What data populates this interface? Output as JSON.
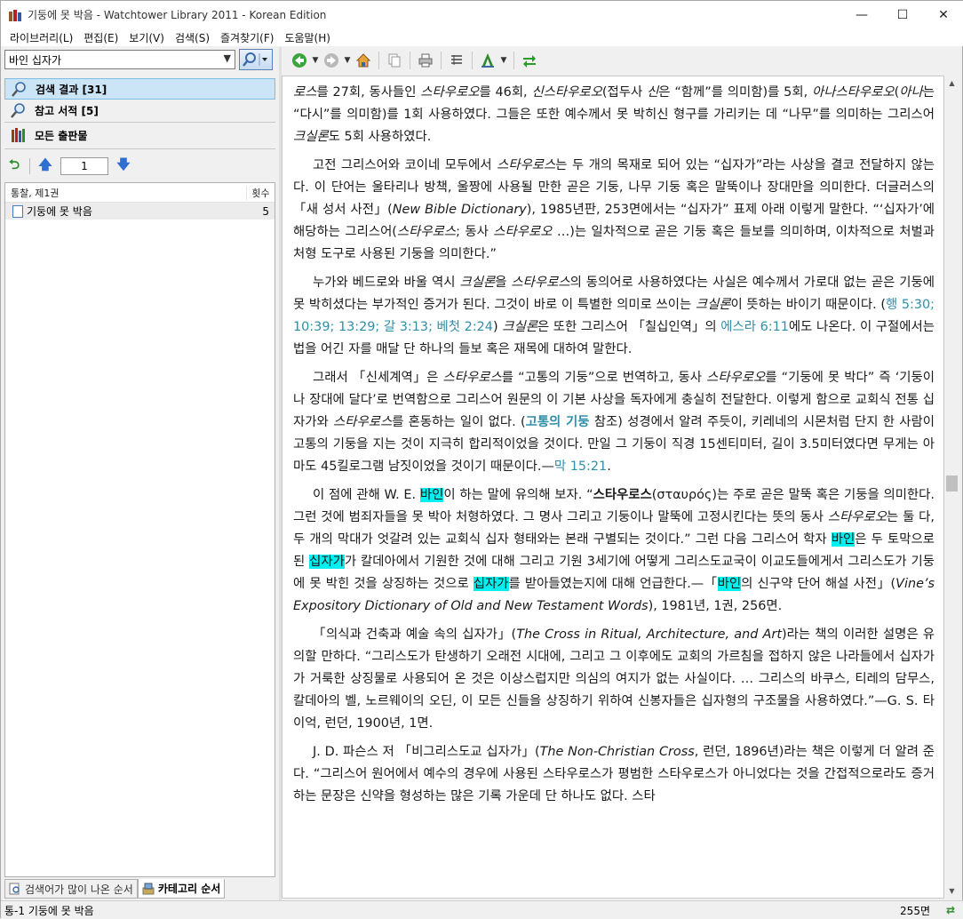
{
  "window": {
    "title": "기둥에 못 박음 - Watchtower Library 2011 - Korean Edition",
    "minimize": "—",
    "maximize": "☐",
    "close": "✕"
  },
  "menu": [
    "라이브러리(L)",
    "편집(E)",
    "보기(V)",
    "검색(S)",
    "즐겨찾기(F)",
    "도움말(H)"
  ],
  "search": {
    "query": "바인 십자가"
  },
  "nav": {
    "results_label": "검색 결과 [31]",
    "references_label": "참고 서적 [5]",
    "all_pubs_label": "모든 출판물"
  },
  "pager": {
    "page": "1"
  },
  "results": {
    "header_title": "통찰, 제1권",
    "header_count": "횟수",
    "rows": [
      {
        "title": "기둥에 못 박음",
        "count": "5"
      }
    ]
  },
  "bottom_tabs": {
    "tab1": "검색어가 많이 나온 순서",
    "tab2": "카테고리 순서"
  },
  "status": {
    "left": "통-1 기둥에 못 박음",
    "pages": "255면"
  },
  "colors": {
    "highlight": "#00f0f0",
    "link": "#2e8fa8",
    "selection": "#cbe5f7"
  }
}
